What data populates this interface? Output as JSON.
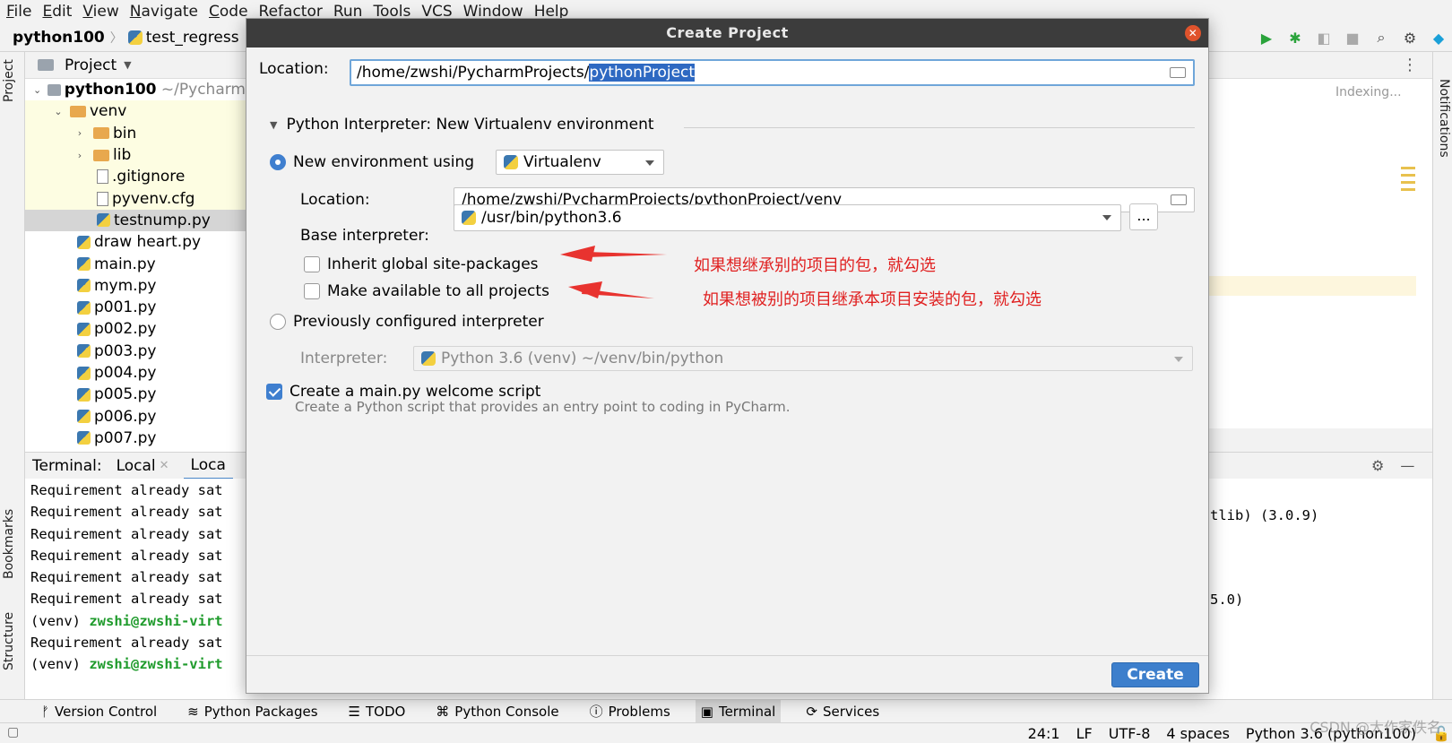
{
  "menu": {
    "file": "F",
    "file_rest": "ile",
    "edit": "E",
    "edit_rest": "dit",
    "view": "V",
    "view_rest": "iew",
    "navigate": "N",
    "navigate_rest": "avigate",
    "code": "C",
    "code_rest": "ode",
    "refactor": "Refactor",
    "run": "Run",
    "tools": "Tools",
    "vcs": "VCS",
    "window": "Window",
    "help": "Help"
  },
  "navbar": {
    "project": "python100",
    "file": "test_regress"
  },
  "left_stripe": {
    "project": "Project",
    "bookmarks": "Bookmarks",
    "structure": "Structure"
  },
  "right_stripe": {
    "notifications": "Notifications"
  },
  "project_panel": {
    "title": "Project",
    "root": "python100",
    "root_path": "~/Pycharm",
    "items": [
      {
        "name": "venv",
        "type": "folder"
      },
      {
        "name": "bin",
        "type": "folder"
      },
      {
        "name": "lib",
        "type": "folder"
      },
      {
        "name": ".gitignore",
        "type": "file"
      },
      {
        "name": "pyvenv.cfg",
        "type": "file"
      },
      {
        "name": "testnump.py",
        "type": "py"
      },
      {
        "name": "draw heart.py",
        "type": "py"
      },
      {
        "name": "main.py",
        "type": "py"
      },
      {
        "name": "mym.py",
        "type": "py"
      },
      {
        "name": "p001.py",
        "type": "py"
      },
      {
        "name": "p002.py",
        "type": "py"
      },
      {
        "name": "p003.py",
        "type": "py"
      },
      {
        "name": "p004.py",
        "type": "py"
      },
      {
        "name": "p005.py",
        "type": "py"
      },
      {
        "name": "p006.py",
        "type": "py"
      },
      {
        "name": "p007.py",
        "type": "py"
      }
    ]
  },
  "editor": {
    "status": "Indexing..."
  },
  "terminal": {
    "label": "Terminal:",
    "tab1": "Local",
    "tab2": "Loca",
    "lines": [
      {
        "prefix": "",
        "text": "Requirement already sat"
      },
      {
        "prefix": "",
        "text": "Requirement already sat"
      },
      {
        "prefix": "",
        "text": "Requirement already sat"
      },
      {
        "prefix": "",
        "text": "Requirement already sat"
      },
      {
        "prefix": "",
        "text": "Requirement already sat"
      },
      {
        "prefix": "",
        "text": "Requirement already sat"
      },
      {
        "prefix": "(venv) ",
        "text": "zwshi@zwshi-virt"
      },
      {
        "prefix": "",
        "text": "Requirement already sat"
      },
      {
        "prefix": "(venv) ",
        "text": "zwshi@zwshi-virt"
      }
    ],
    "right_line1": "tlib) (3.0.9)",
    "right_line2": "5.0)"
  },
  "dialog": {
    "title": "Create Project",
    "location_label": "Location:",
    "location_prefix": "/home/zwshi/PycharmProjects/",
    "location_selected": "pythonProject",
    "interpreter_section": "Python Interpreter: New Virtualenv environment",
    "new_env_label": "New environment using",
    "env_tool": "Virtualenv",
    "venv_location_label": "Location:",
    "venv_location": "/home/zwshi/PycharmProjects/pythonProject/venv",
    "base_interp_label": "Base interpreter:",
    "base_interp": "/usr/bin/python3.6",
    "dots": "...",
    "inherit_label": "Inherit global site-packages",
    "available_label": "Make available to all projects",
    "prev_interp_label": "Previously configured interpreter",
    "interp_label": "Interpreter:",
    "interp_value": "Python 3.6 (venv) ~/venv/bin/python",
    "welcome_label": "Create a main.py welcome script",
    "welcome_hint": "Create a Python script that provides an entry point to coding in PyCharm.",
    "create_button": "Create"
  },
  "annotations": {
    "note1": "如果想继承别的项目的包，就勾选",
    "note2": "如果想被别的项目继承本项目安装的包，就勾选"
  },
  "tool_tabs": {
    "version_control": "Version Control",
    "python_packages": "Python Packages",
    "todo": "TODO",
    "python_console": "Python Console",
    "problems": "Problems",
    "terminal": "Terminal",
    "services": "Services"
  },
  "status": {
    "position": "24:1",
    "line_sep": "LF",
    "encoding": "UTF-8",
    "indent": "4 spaces",
    "interpreter": "Python 3.6 (python100)"
  },
  "watermark": "CSDN @大作家佚名",
  "colors": {
    "accent": "#3d7fcc",
    "annotation": "#e02020",
    "prompt_green": "#1f9b2c"
  }
}
